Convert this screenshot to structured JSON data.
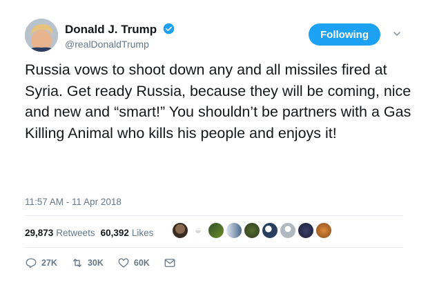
{
  "header": {
    "display_name": "Donald J. Trump",
    "handle": "@realDonaldTrump",
    "follow_label": "Following"
  },
  "tweet": {
    "text": "Russia vows to shoot down any and all missiles fired at Syria. Get ready Russia, because they will be coming, nice and new and “smart!” You shouldn’t be partners with a Gas Killing Animal who kills his people and enjoys it!",
    "timestamp": "11:57 AM - 11 Apr 2018"
  },
  "stats": {
    "retweets_count": "29,873",
    "retweets_label": "Retweets",
    "likes_count": "60,392",
    "likes_label": "Likes"
  },
  "actions": {
    "replies": "27K",
    "retweets": "30K",
    "likes": "60K"
  },
  "colors": {
    "accent": "#1da1f2",
    "secondary_text": "#657786",
    "divider": "#e6ecf0"
  }
}
